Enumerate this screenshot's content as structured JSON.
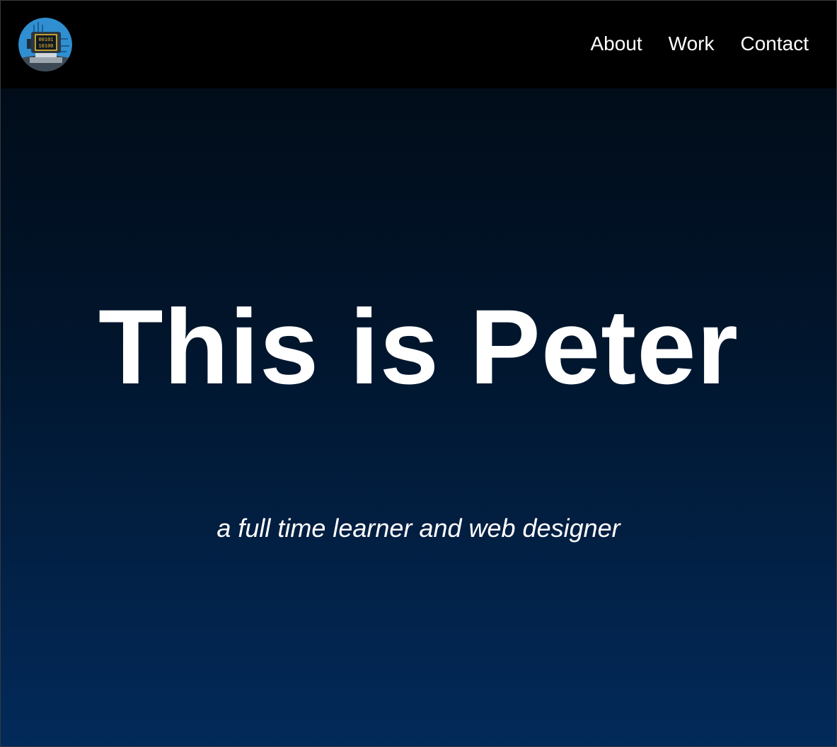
{
  "header": {
    "logo_icon": "computer-binary-logo-icon",
    "logo_screen_lines": [
      "00101",
      "10100"
    ],
    "nav": [
      {
        "label": "About"
      },
      {
        "label": "Work"
      },
      {
        "label": "Contact"
      }
    ]
  },
  "hero": {
    "title": "This is Peter",
    "subtitle": "a full time learner and web designer"
  },
  "colors": {
    "header_bg": "#000000",
    "gradient_top": "#010912",
    "gradient_bottom": "#022a5a",
    "text": "#ffffff",
    "logo_bg": "#2f8fd1",
    "logo_screen": "#f2c230"
  }
}
